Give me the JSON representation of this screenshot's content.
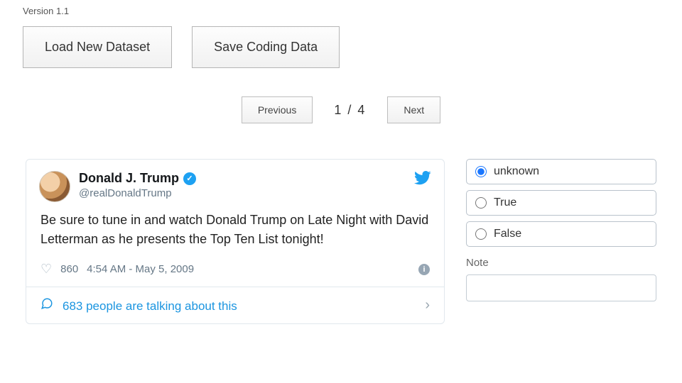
{
  "version_label": "Version 1.1",
  "toolbar": {
    "load_label": "Load New Dataset",
    "save_label": "Save Coding Data"
  },
  "pager": {
    "prev_label": "Previous",
    "next_label": "Next",
    "position": "1 / 4"
  },
  "tweet": {
    "display_name": "Donald J. Trump",
    "handle": "@realDonaldTrump",
    "body": "Be sure to tune in and watch Donald Trump on Late Night with David Letterman as he presents the Top Ten List tonight!",
    "like_count": "860",
    "timestamp": "4:54 AM - May 5, 2009",
    "replies_text": "683 people are talking about this"
  },
  "coding": {
    "options": {
      "unknown": "unknown",
      "true": "True",
      "false": "False"
    },
    "selected": "unknown",
    "note_label": "Note",
    "note_value": ""
  }
}
